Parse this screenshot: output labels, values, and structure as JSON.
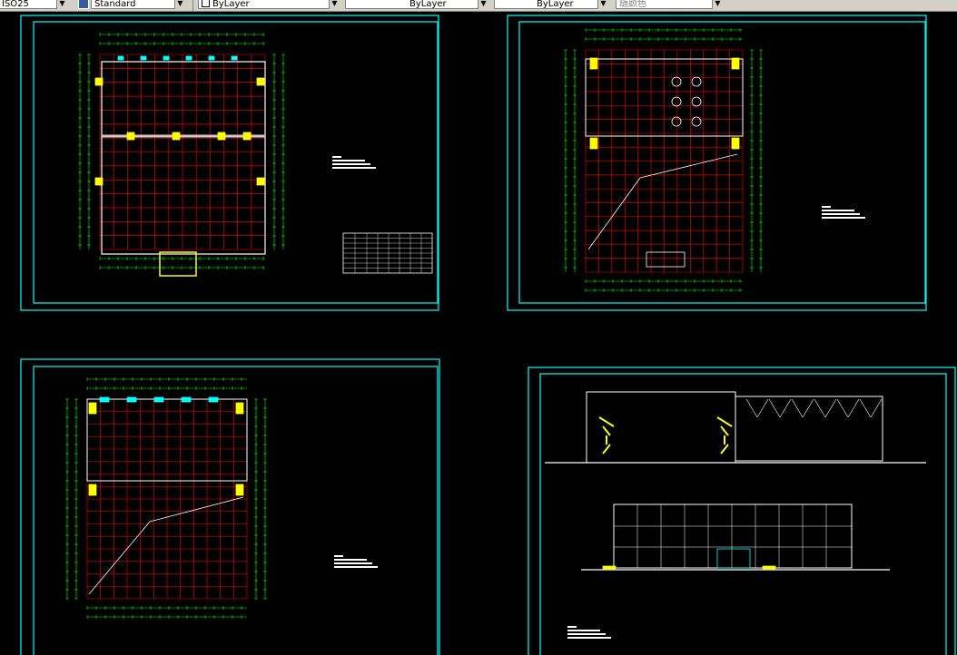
{
  "toolbar": {
    "field1": "ISO25",
    "field2": "Standard",
    "layer_select": "ByLayer",
    "linetype_select": "ByLayer",
    "lineweight_select": "ByLayer",
    "plotstyle_select": "随颜色",
    "arrow": "▼"
  },
  "colors": {
    "background": "#000000",
    "sheet_border": "#00ffff",
    "grid_red": "#ff0000",
    "dim_green": "#00ff00",
    "wall_white": "#ffffff",
    "column_yellow": "#ffff00",
    "glass_cyan": "#00ffff"
  },
  "icons": {
    "layer": "layer-square-icon",
    "dropdown": "chevron-down-icon"
  }
}
